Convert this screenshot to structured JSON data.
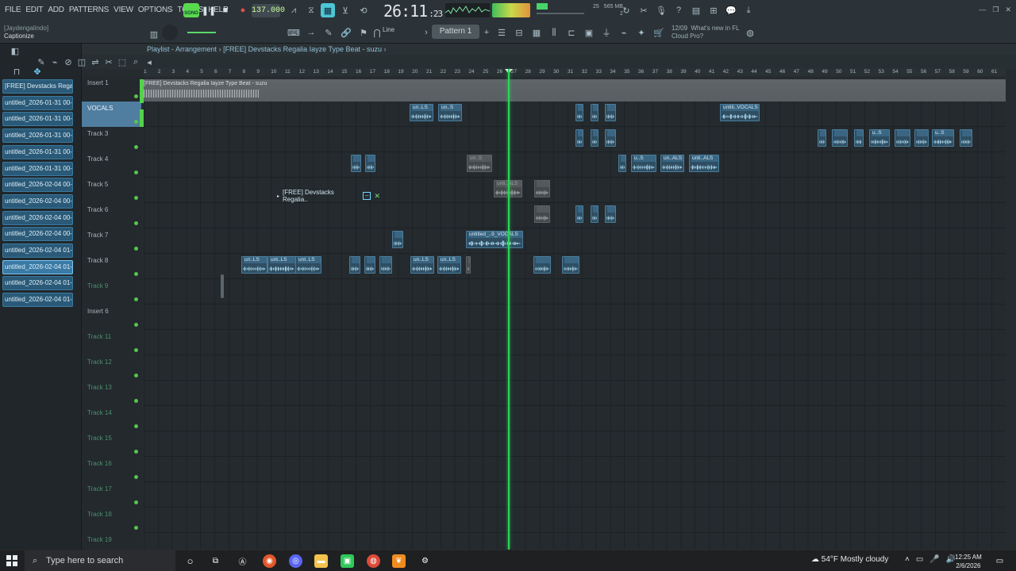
{
  "menu": [
    "FILE",
    "EDIT",
    "ADD",
    "PATTERNS",
    "VIEW",
    "OPTIONS",
    "TOOLS",
    "HELP"
  ],
  "transport": {
    "mode_label": "SONG",
    "tempo": "137.000",
    "time": "26:11",
    "time_sub": ":23",
    "mem": "565 MB",
    "cpu": "25",
    "poly": "2"
  },
  "project": {
    "user": "[Jaydengalindo]",
    "name": "Captionize"
  },
  "toolbar2": {
    "snap": "Line",
    "pattern": "Pattern 1"
  },
  "news": {
    "date": "12/09",
    "title": "What's new in FL",
    "subtitle": "Cloud Pro?"
  },
  "playlist": {
    "title": "Playlist - Arrangement",
    "breadcrumb": "[FREE] Devstacks  Regalia  Iayze Type Beat - suzu",
    "overview_label": "[FREE] Devstacks  Regalia  Iayze Type Beat - suzu",
    "ruler": [
      "1",
      "2",
      "3",
      "4",
      "5",
      "6",
      "7",
      "8",
      "9",
      "10",
      "11",
      "12",
      "13",
      "14",
      "15",
      "16",
      "17",
      "18",
      "19",
      "20",
      "21",
      "22",
      "23",
      "24",
      "25",
      "26",
      "27",
      "28",
      "29",
      "30",
      "31",
      "32",
      "33",
      "34",
      "35",
      "36",
      "37",
      "38",
      "39",
      "40",
      "41",
      "42",
      "43",
      "44",
      "45",
      "46",
      "47",
      "48",
      "49",
      "50",
      "51",
      "52",
      "53",
      "54",
      "55",
      "56",
      "57",
      "58",
      "59",
      "60",
      "61"
    ],
    "tracks": [
      {
        "label": "Insert 1",
        "dim": false
      },
      {
        "label": "VOCALS",
        "dim": false
      },
      {
        "label": "Track 3",
        "dim": false
      },
      {
        "label": "Track 4",
        "dim": false
      },
      {
        "label": "Track 5",
        "dim": false
      },
      {
        "label": "Track 6",
        "dim": false
      },
      {
        "label": "Track 7",
        "dim": false
      },
      {
        "label": "Track 8",
        "dim": false
      },
      {
        "label": "Track 9",
        "dim": true
      },
      {
        "label": "Insert 6",
        "dim": false
      },
      {
        "label": "Track 11",
        "dim": true
      },
      {
        "label": "Track 12",
        "dim": true
      },
      {
        "label": "Track 13",
        "dim": true
      },
      {
        "label": "Track 14",
        "dim": true
      },
      {
        "label": "Track 15",
        "dim": true
      },
      {
        "label": "Track 16",
        "dim": true
      },
      {
        "label": "Track 17",
        "dim": true
      },
      {
        "label": "Track 18",
        "dim": true
      },
      {
        "label": "Track 19",
        "dim": true
      }
    ],
    "popup": "[FREE] Devstacks  Regalia.."
  },
  "clip_labels": {
    "un_ls": "un..LS",
    "un_s": "un..S",
    "unti_vocals": "untiti..VOCALS",
    "u_s": "u..S",
    "un_s2": "un..S",
    "unti_als": "unti..ALS",
    "un_als": "un..ALS",
    "untitled_vocals": "untitled_..9_VOCALS",
    "unt_ls": "unt..LS"
  },
  "browser": {
    "items": [
      "[FREE] Devstacks  Regali..",
      "untitled_2026-01-31 00-..",
      "untitled_2026-01-31 00-..",
      "untitled_2026-01-31 00-..",
      "untitled_2026-01-31 00-..",
      "untitled_2026-01-31 00-..",
      "untitled_2026-02-04 00-..",
      "untitled_2026-02-04 00-..",
      "untitled_2026-02-04 00-..",
      "untitled_2026-02-04 00-..",
      "untitled_2026-02-04 01-..",
      "untitled_2026-02-04 01-..",
      "untitled_2026-02-04 01-..",
      "untitled_2026-02-04 01-.."
    ]
  },
  "taskbar": {
    "search_placeholder": "Type here to search",
    "weather": "54°F  Mostly cloudy",
    "time": "12:25 AM",
    "date": "2/6/2026"
  },
  "colors": {
    "accent": "#55c64a",
    "clip": "#2f4e62",
    "playhead": "#2ed459"
  }
}
